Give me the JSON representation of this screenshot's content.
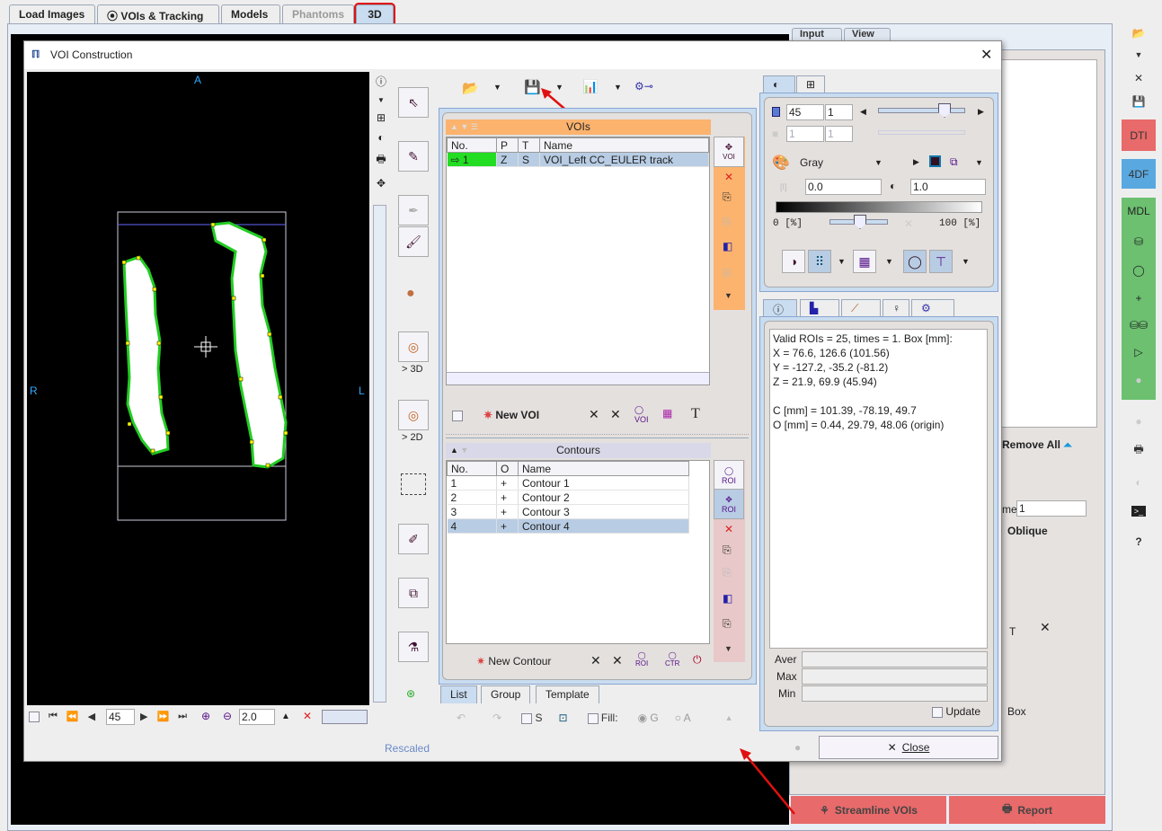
{
  "main_tabs": [
    {
      "label": "Load Images",
      "state": "normal"
    },
    {
      "label": "VOIs & Tracking",
      "state": "normal",
      "icon": "target-icon"
    },
    {
      "label": "Models",
      "state": "normal"
    },
    {
      "label": "Phantoms",
      "state": "disabled"
    },
    {
      "label": "3D",
      "state": "selected"
    }
  ],
  "background": {
    "tabs": [
      "Input",
      "View"
    ],
    "remove_all": "Remove All",
    "frame_label": "me",
    "frame_value": "1",
    "oblique": "Oblique",
    "t_label": "T",
    "box_label": "Box",
    "streamline_button": "Streamline VOIs",
    "report_button": "Report"
  },
  "right_toolbar": {
    "dti": "DTI",
    "df": "4DF",
    "mdl": "MDL",
    "help": "?",
    "colors": {
      "dti": "#e86a6a",
      "df": "#5aa8e0",
      "mdl": "#6cc070"
    }
  },
  "dialog": {
    "title": "VOI Construction",
    "viewer": {
      "orient_top": "A",
      "orient_left": "R",
      "orient_right": "L",
      "slice": "45",
      "zoom": "2.0",
      "status": "Rescaled"
    },
    "vertical_tools": {
      "to3d": "> 3D",
      "to2d": "> 2D"
    },
    "vois": {
      "header": "VOIs",
      "columns": [
        "No.",
        "P",
        "T",
        "Name"
      ],
      "rows": [
        {
          "no": "1",
          "p": "Z",
          "t": "S",
          "name": "VOI_Left CC_EULER track",
          "selected": true
        }
      ],
      "new_voi": "New VOI",
      "side_label": "VOI",
      "header_color": "#fbb36e"
    },
    "contours": {
      "header": "Contours",
      "columns": [
        "No.",
        "O",
        "Name"
      ],
      "rows": [
        {
          "no": "1",
          "o": "+",
          "name": "Contour 1"
        },
        {
          "no": "2",
          "o": "+",
          "name": "Contour 2"
        },
        {
          "no": "3",
          "o": "+",
          "name": "Contour 3"
        },
        {
          "no": "4",
          "o": "+",
          "name": "Contour 4",
          "selected": true
        }
      ],
      "new_contour": "New Contour",
      "roi_label": "ROI",
      "ctr_label": "CTR"
    },
    "list_tabs": [
      "List",
      "Group",
      "Template"
    ],
    "bottom_toolbar": {
      "s_label": "S",
      "fill_label": "Fill:",
      "g_label": "G",
      "a_label": "A"
    },
    "display": {
      "slice_value": "45",
      "slice_step": "1",
      "frame_value": "1",
      "frame_step": "1",
      "slice_slider_fraction": 0.75,
      "colormap": "Gray",
      "min_value": "0.0",
      "max_value": "1.0",
      "range_low": "0  [%]",
      "range_high": "100  [%]"
    },
    "info": {
      "lines": [
        "Valid ROIs = 25, times = 1.  Box [mm]:",
        "X = 76.6, 126.6 (101.56)",
        "Y = -127.2, -35.2 (-81.2)",
        "Z = 21.9, 69.9 (45.94)",
        "",
        "C [mm] = 101.39, -78.19, 49.7",
        "O [mm] = 0.44, 29.79, 48.06 (origin)"
      ],
      "aver_label": "Aver",
      "max_label": "Max",
      "min_label": "Min",
      "update_label": "Update"
    },
    "close_button": "Close"
  }
}
